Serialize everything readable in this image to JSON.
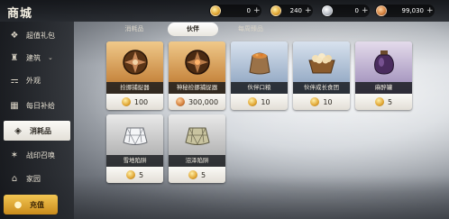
{
  "header": {
    "title": "商城"
  },
  "currencies": [
    {
      "icon": "gold-coin-icon",
      "value": "0",
      "plus": "+"
    },
    {
      "icon": "gold-coin-icon",
      "value": "240",
      "plus": "+"
    },
    {
      "icon": "silver-coin-icon",
      "value": "0",
      "plus": "+"
    },
    {
      "icon": "bronze-coin-icon",
      "value": "99,030",
      "plus": "+"
    }
  ],
  "sidebar": {
    "items": [
      {
        "label": "超值礼包",
        "icon": "gift-icon"
      },
      {
        "label": "建筑",
        "icon": "building-icon",
        "chevron": "⌄"
      },
      {
        "label": "外观",
        "icon": "outfit-icon"
      },
      {
        "label": "每日补给",
        "icon": "calendar-icon"
      },
      {
        "label": "消耗品",
        "icon": "consumable-icon",
        "active": true
      },
      {
        "label": "战印召唤",
        "icon": "summon-icon"
      },
      {
        "label": "家园",
        "icon": "home-icon"
      },
      {
        "label": "充值",
        "icon": "coins-icon"
      }
    ]
  },
  "tabs": [
    {
      "label": "消耗品"
    },
    {
      "label": "伙伴",
      "active": true
    },
    {
      "label": "每周臻品"
    }
  ],
  "items": [
    {
      "name": "捡挪捕捉器",
      "price": "100",
      "currency": "gold",
      "rarity": "orange",
      "icon": "capture-ball-icon"
    },
    {
      "name": "神秘捡挪捕捉器",
      "price": "300,000",
      "currency": "bronze",
      "rarity": "orange",
      "icon": "capture-ball-icon"
    },
    {
      "name": "伙伴口粮",
      "price": "10",
      "currency": "gold",
      "rarity": "blue",
      "icon": "food-sack-icon"
    },
    {
      "name": "伙伴成长食团",
      "price": "10",
      "currency": "gold",
      "rarity": "blue",
      "icon": "food-basket-icon"
    },
    {
      "name": "麻醉罐",
      "price": "5",
      "currency": "gold",
      "rarity": "purple",
      "icon": "potion-jar-icon"
    },
    {
      "name": "雪地陷阱",
      "price": "5",
      "currency": "gold",
      "rarity": "gray",
      "icon": "net-trap-icon"
    },
    {
      "name": "沼泽陷阱",
      "price": "5",
      "currency": "gold",
      "rarity": "gray",
      "icon": "net-trap-icon"
    }
  ],
  "colors": {
    "gold_accent": "#e0a431",
    "active_tab_bg": "#ffffff",
    "recharge_bg": "#f3c653"
  }
}
